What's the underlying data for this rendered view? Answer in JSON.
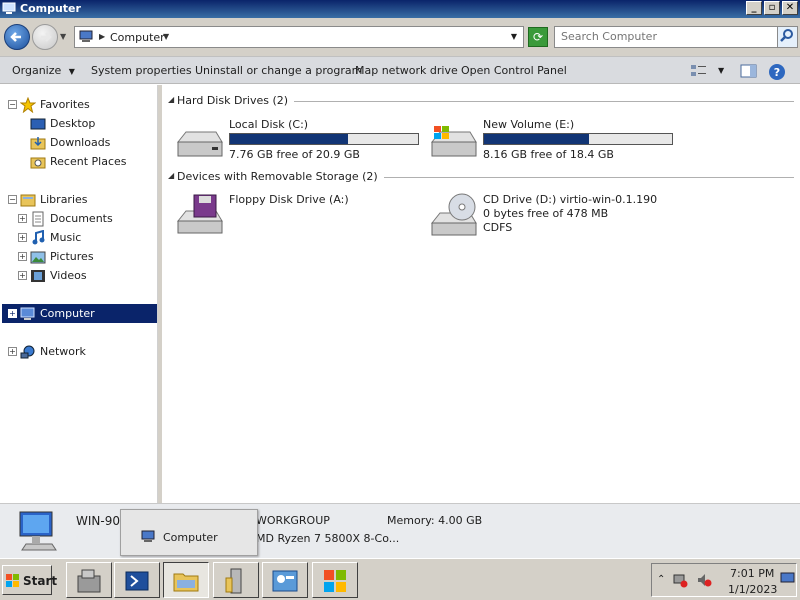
{
  "window": {
    "title": "Computer",
    "minimize": "_",
    "maximize": "▫",
    "close": "✕"
  },
  "address": {
    "crumb": "Computer",
    "search_placeholder": "Search Computer"
  },
  "toolbar": {
    "organize": "Organize",
    "system_properties": "System properties",
    "uninstall": "Uninstall or change a program",
    "map_drive": "Map network drive",
    "control_panel": "Open Control Panel"
  },
  "nav": {
    "favorites": "Favorites",
    "desktop": "Desktop",
    "downloads": "Downloads",
    "recent": "Recent Places",
    "libraries": "Libraries",
    "documents": "Documents",
    "music": "Music",
    "pictures": "Pictures",
    "videos": "Videos",
    "computer": "Computer",
    "network": "Network"
  },
  "groups": {
    "hard_disks": "Hard Disk Drives (2)",
    "removable": "Devices with Removable Storage (2)"
  },
  "drives": {
    "c": {
      "name": "Local Disk (C:)",
      "free": "7.76 GB free of 20.9 GB",
      "used_fraction": 0.63
    },
    "e": {
      "name": "New Volume (E:)",
      "free": "8.16 GB free of 18.4 GB",
      "used_fraction": 0.56
    },
    "a": {
      "name": "Floppy Disk Drive (A:)"
    },
    "d": {
      "name": "CD Drive (D:) virtio-win-0.1.190",
      "free": "0 bytes free of 478 MB",
      "fs": "CDFS"
    }
  },
  "details": {
    "pc_name": "WIN-90",
    "workgroup": "WORKGROUP",
    "memory": "Memory:  4.00 GB",
    "processor": "MD Ryzen 7 5800X 8-Co..."
  },
  "tooltip": {
    "label": "Computer"
  },
  "taskbar": {
    "start": "Start",
    "time": "7:01 PM",
    "date": "1/1/2023"
  },
  "colors": {
    "selection": "#0a246a",
    "drive_bar": "#123575",
    "titlebar": "#0a246a"
  }
}
